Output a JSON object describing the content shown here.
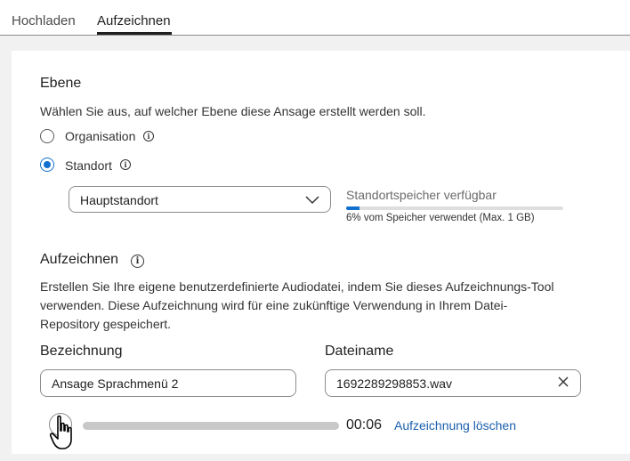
{
  "tabs": [
    {
      "label": "Hochladen",
      "active": false
    },
    {
      "label": "Aufzeichnen",
      "active": true
    }
  ],
  "level": {
    "title": "Ebene",
    "description": "Wählen Sie aus, auf welcher Ebene diese Ansage erstellt werden soll.",
    "options": [
      {
        "label": "Organisation",
        "checked": false
      },
      {
        "label": "Standort",
        "checked": true
      }
    ],
    "location_select": {
      "value": "Hauptstandort"
    },
    "storage": {
      "title": "Standortspeicher verfügbar",
      "used_percent": 6,
      "note": "6% vom Speicher verwendet (Max. 1 GB)"
    }
  },
  "record": {
    "title": "Aufzeichnen",
    "description_lines": [
      "Erstellen Sie Ihre eigene benutzerdefinierte Audiodatei, indem Sie dieses Aufzeichnungs-Tool",
      "verwenden. Diese Aufzeichnung wird für eine zukünftige Verwendung in Ihrem Datei-",
      "Repository gespeichert."
    ],
    "name_label": "Bezeichnung",
    "name_value": "Ansage Sprachmenü 2",
    "filename_label": "Dateiname",
    "filename_value": "1692289298853.wav",
    "duration": "00:06",
    "delete_link": "Aufzeichnung löschen"
  },
  "colors": {
    "accent": "#1170cf",
    "link": "#1a5fad"
  }
}
